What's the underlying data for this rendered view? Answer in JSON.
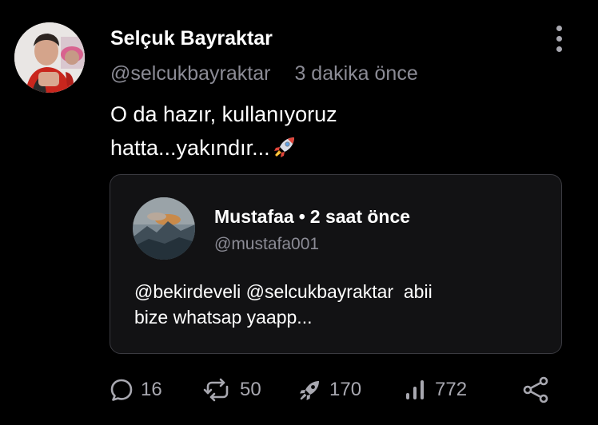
{
  "post": {
    "author": {
      "name": "Selçuk Bayraktar",
      "handle": "@selcukbayraktar",
      "avatar_icon": "profile-photo-icon"
    },
    "timestamp": "3 dakika önce",
    "text_lines": [
      "O da hazır, kullanıyoruz",
      "hatta...yakındır..."
    ],
    "emoji": "rocket-emoji-icon",
    "more_icon": "more-vertical-icon"
  },
  "quote": {
    "author_name": "Mustafaa",
    "separator": "•",
    "timestamp": "2 saat önce",
    "handle": "@mustafa001",
    "avatar_icon": "landscape-photo-icon",
    "text_lines": [
      "@bekirdeveli @selcukbayraktar  abii",
      "bize whatsap yaapp..."
    ]
  },
  "actions": {
    "replies": {
      "icon": "reply-bubble-icon",
      "count": "16"
    },
    "reposts": {
      "icon": "repost-icon",
      "count": "50"
    },
    "boosts": {
      "icon": "rocket-icon",
      "count": "170"
    },
    "views": {
      "icon": "views-bar-chart-icon",
      "count": "772"
    },
    "share": {
      "icon": "share-icon"
    }
  },
  "colors": {
    "background": "#000000",
    "text_primary": "#ffffff",
    "text_secondary": "#8b8b95",
    "card_background": "#121214",
    "card_border": "#3a3a40"
  }
}
